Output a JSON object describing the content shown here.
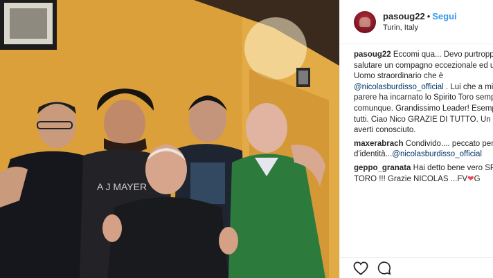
{
  "post": {
    "username": "pasoug22",
    "separator": "•",
    "follow_label": "Segui",
    "location": "Turin, Italy"
  },
  "caption": {
    "username": "pasoug22",
    "lines": [
      "Eccomi qua... Devo purtroppo",
      "salutare un compagno eccezionale ed u",
      "Uomo straordinario che è"
    ],
    "mention": "@nicolasburdisso_official",
    "after_mention": " . Lui che a mic",
    "lines2": [
      "parere ha incarnato lo Spirito Toro semp",
      "comunque. Grandissimo Leader! Esempi",
      "tutti. Ciao Nico GRAZIE DI TUTTO. Un or",
      "averti conosciuto."
    ]
  },
  "comments": [
    {
      "username": "maxerabrach",
      "text": " Condivido.... peccato per l",
      "line2_prefix": "d'identità...",
      "mention": "@nicolasburdisso_official"
    },
    {
      "username": "geppo_granata",
      "text": " Hai detto bene vero SPI",
      "line2": "TORO !!! Grazie NICOLAS ...FV",
      "heart": "❤",
      "line2_suffix": "G"
    }
  ],
  "actions": {
    "like_icon": "heart-outline-icon",
    "comment_icon": "comment-bubble-icon"
  },
  "colors": {
    "follow": "#3897f0",
    "mention": "#003569",
    "heart": "#ed4956",
    "wall": "#d99a34"
  }
}
